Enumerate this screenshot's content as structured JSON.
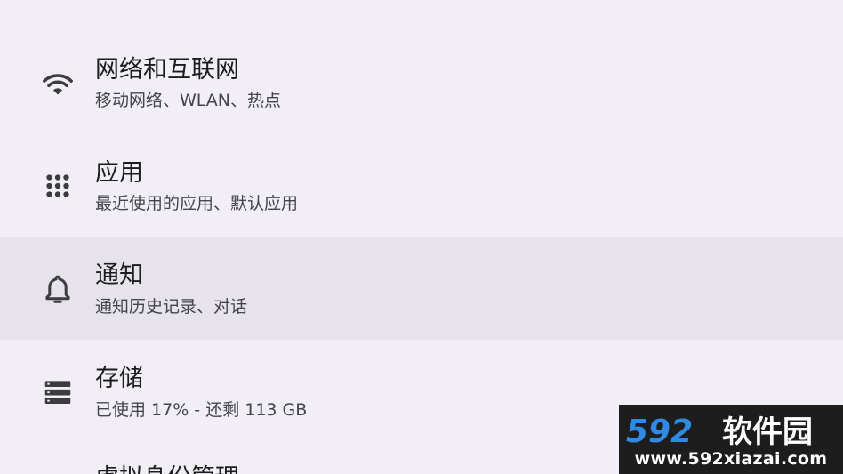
{
  "settings": {
    "items": [
      {
        "icon": "wifi-icon",
        "title": "网络和互联网",
        "subtitle": "移动网络、WLAN、热点"
      },
      {
        "icon": "apps-grid-icon",
        "title": "应用",
        "subtitle": "最近使用的应用、默认应用"
      },
      {
        "icon": "bell-icon",
        "title": "通知",
        "subtitle": "通知历史记录、对话"
      },
      {
        "icon": "storage-icon",
        "title": "存储",
        "subtitle": "已使用 17% - 还剩 113 GB"
      },
      {
        "title": "虚拟身份管理"
      }
    ]
  },
  "watermark": {
    "brand_number": "592",
    "brand_text": "软件园",
    "url": "www.592xiazai.com"
  },
  "colors": {
    "background": "#f1eff5",
    "highlight": "#e6e4ea",
    "title": "#1c1b1f",
    "subtitle": "#45444b",
    "watermark_bg": "#1d1d1d",
    "watermark_blue": "#2f8ae6"
  }
}
